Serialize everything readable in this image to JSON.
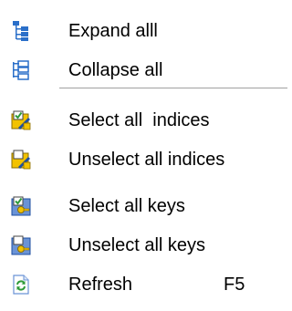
{
  "menu": {
    "items": [
      {
        "label": "Expand alll",
        "icon": "tree-expand-icon"
      },
      {
        "label": "Collapse all",
        "icon": "tree-collapse-icon"
      },
      {
        "label": "Select all  indices",
        "icon": "select-indices-icon"
      },
      {
        "label": "Unselect all indices",
        "icon": "unselect-indices-icon"
      },
      {
        "label": "Select all keys",
        "icon": "select-keys-icon"
      },
      {
        "label": "Unselect all keys",
        "icon": "unselect-keys-icon"
      },
      {
        "label": "Refresh",
        "shortcut": "F5",
        "icon": "refresh-icon"
      }
    ]
  },
  "colors": {
    "icon_blue": "#2a6fc9",
    "icon_yellow": "#f2c200",
    "icon_green": "#2e9a3a",
    "separator": "#a0a0a0"
  }
}
